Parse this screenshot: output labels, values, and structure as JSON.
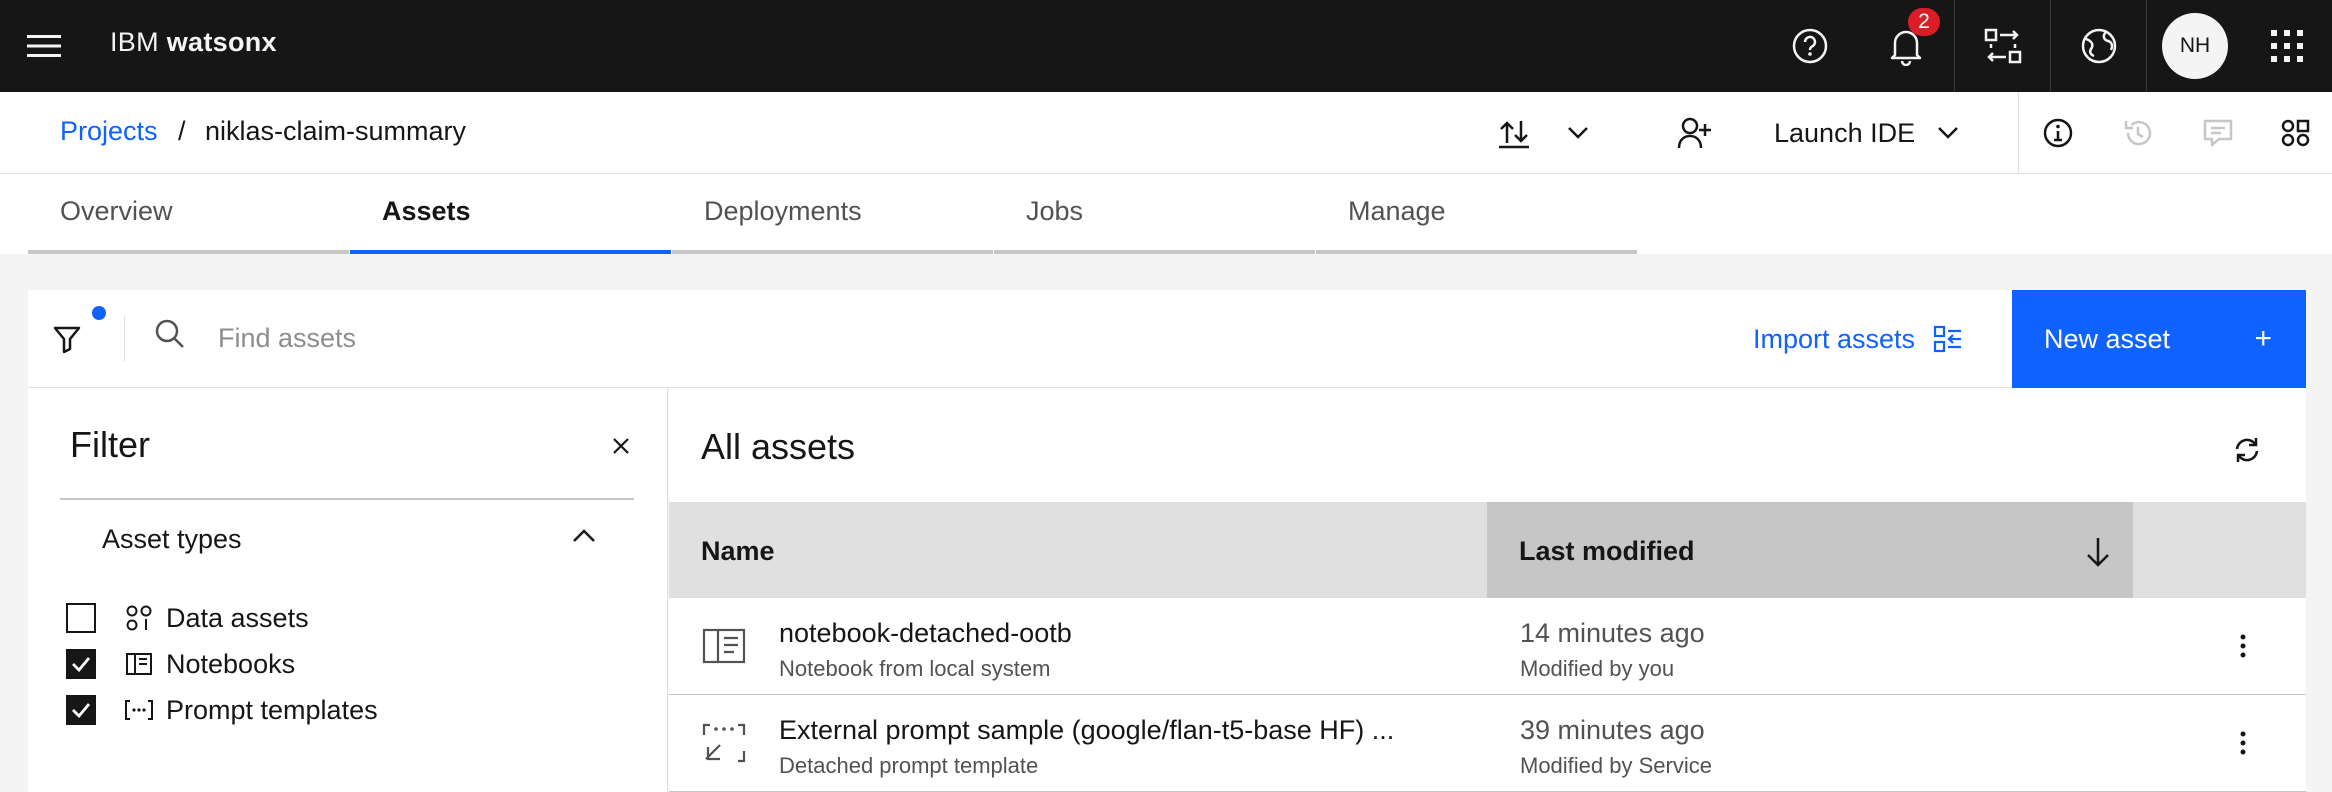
{
  "header": {
    "brand_prefix": "IBM",
    "brand_name": "watsonx",
    "notification_count": "2",
    "avatar_initials": "NH",
    "icons": [
      "menu-icon",
      "help-icon",
      "notification-icon",
      "switch-account-icon",
      "globe-icon",
      "app-switcher-icon"
    ]
  },
  "breadcrumb": {
    "parent": "Projects",
    "separator": "/",
    "current": "niklas-claim-summary"
  },
  "project_actions": {
    "launch_ide": "Launch IDE",
    "icons": [
      "import-export-icon",
      "chevron-down-icon",
      "add-collaborator-icon",
      "info-icon",
      "history-icon",
      "comments-icon",
      "side-panel-icon"
    ]
  },
  "tabs": [
    {
      "label": "Overview",
      "active": false
    },
    {
      "label": "Assets",
      "active": true
    },
    {
      "label": "Deployments",
      "active": false
    },
    {
      "label": "Jobs",
      "active": false
    },
    {
      "label": "Manage",
      "active": false
    }
  ],
  "toolbar": {
    "search_placeholder": "Find assets",
    "import_label": "Import assets",
    "new_asset_label": "New asset",
    "new_asset_icon": "+"
  },
  "filter": {
    "title": "Filter",
    "section_title": "Asset types",
    "options": [
      {
        "label": "Data assets",
        "checked": false,
        "icon": "data-assets-icon"
      },
      {
        "label": "Notebooks",
        "checked": true,
        "icon": "notebook-icon"
      },
      {
        "label": "Prompt templates",
        "checked": true,
        "icon": "prompt-template-icon"
      }
    ]
  },
  "assets": {
    "title": "All assets",
    "columns": [
      "Name",
      "Last modified"
    ],
    "sorted_column": "Last modified",
    "sort_direction": "descending",
    "rows": [
      {
        "name": "notebook-detached-ootb",
        "subtitle": "Notebook from local system",
        "modified": "14 minutes ago",
        "modified_by": "Modified by you",
        "icon": "notebook-icon"
      },
      {
        "name": "External prompt sample (google/flan-t5-base HF) ...",
        "subtitle": "Detached prompt template",
        "modified": "39 minutes ago",
        "modified_by": "Modified by Service",
        "icon": "detached-prompt-icon"
      }
    ]
  },
  "colors": {
    "header_bg": "#161616",
    "accent": "#0f62fe",
    "badge": "#da1e28",
    "table_header": "#e0e0e0",
    "page_bg": "#f4f4f4"
  }
}
